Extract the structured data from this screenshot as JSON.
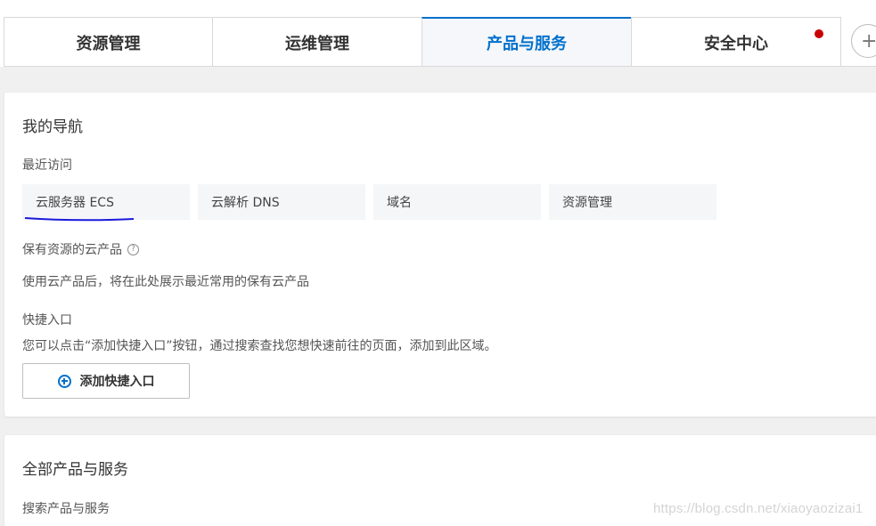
{
  "tabs": [
    {
      "label": "资源管理"
    },
    {
      "label": "运维管理"
    },
    {
      "label": "产品与服务"
    },
    {
      "label": "安全中心"
    }
  ],
  "add_tab": {
    "label": "+"
  },
  "nav": {
    "title": "我的导航",
    "recent_label": "最近访问",
    "recent": [
      {
        "label": "云服务器 ECS"
      },
      {
        "label": "云解析 DNS"
      },
      {
        "label": "域名"
      },
      {
        "label": "资源管理"
      }
    ],
    "owned_label": "保有资源的云产品",
    "owned_help": "?",
    "owned_desc": "使用云产品后，将在此处展示最近常用的保有云产品",
    "shortcut_label": "快捷入口",
    "shortcut_desc": "您可以点击“添加快捷入口”按钮，通过搜索查找您想快速前往的页面，添加到此区域。",
    "add_shortcut_label": "添加快捷入口"
  },
  "all_products": {
    "title": "全部产品与服务",
    "search_label": "搜索产品与服务"
  },
  "watermark": "https://blog.csdn.net/xiaoyaozizai1",
  "colors": {
    "accent": "#0070cc",
    "notification_dot": "#c80000",
    "underline_annotation": "#1a1adb"
  }
}
